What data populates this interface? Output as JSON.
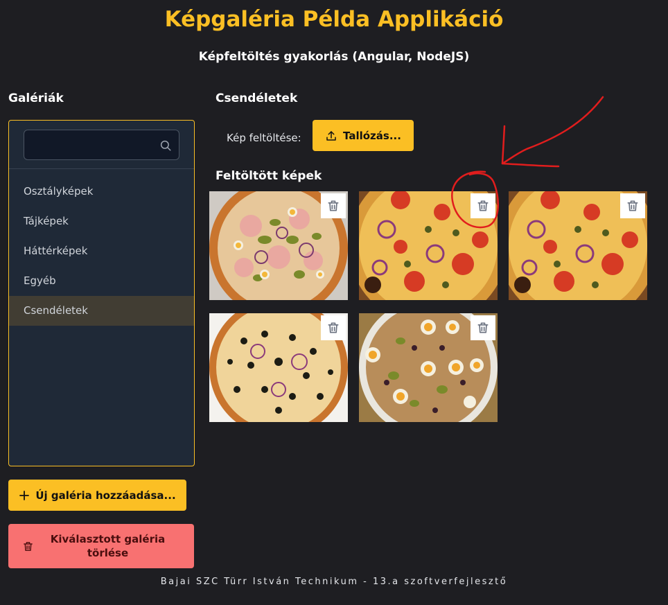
{
  "app": {
    "title": "Képgaléria Példa Applikáció",
    "subtitle": "Képfeltöltés gyakorlás (Angular, NodeJS)",
    "accent_color": "#fbbf24",
    "danger_color": "#f87171"
  },
  "sidebar": {
    "heading": "Galériák",
    "search": {
      "placeholder": "",
      "value": "",
      "icon": "search-icon"
    },
    "items": [
      {
        "label": "Osztályképek",
        "selected": false
      },
      {
        "label": "Tájképek",
        "selected": false
      },
      {
        "label": "Háttérképek",
        "selected": false
      },
      {
        "label": "Egyéb",
        "selected": false
      },
      {
        "label": "Csendéletek",
        "selected": true
      }
    ],
    "add_button": {
      "label": "Új galéria hozzáadása...",
      "icon": "plus-icon"
    },
    "delete_button": {
      "label": "Kiválasztott galéria törlése",
      "icon": "trash-icon"
    }
  },
  "main": {
    "gallery_title": "Csendéletek",
    "upload": {
      "label": "Kép feltöltése:",
      "button_label": "Tallózás...",
      "icon": "upload-icon"
    },
    "uploaded_title": "Feltöltött képek",
    "images": [
      {
        "name": "pizza-1",
        "delete_icon": "trash-icon"
      },
      {
        "name": "pizza-2",
        "delete_icon": "trash-icon",
        "highlighted": true
      },
      {
        "name": "pizza-3",
        "delete_icon": "trash-icon"
      },
      {
        "name": "pizza-4",
        "delete_icon": "trash-icon"
      },
      {
        "name": "pizza-5",
        "delete_icon": "trash-icon"
      }
    ]
  },
  "footer": {
    "text": "Bajai SZC Türr István Technikum - 13.a szoftverfejlesztő"
  },
  "annotation": {
    "color": "#e11d1d"
  }
}
